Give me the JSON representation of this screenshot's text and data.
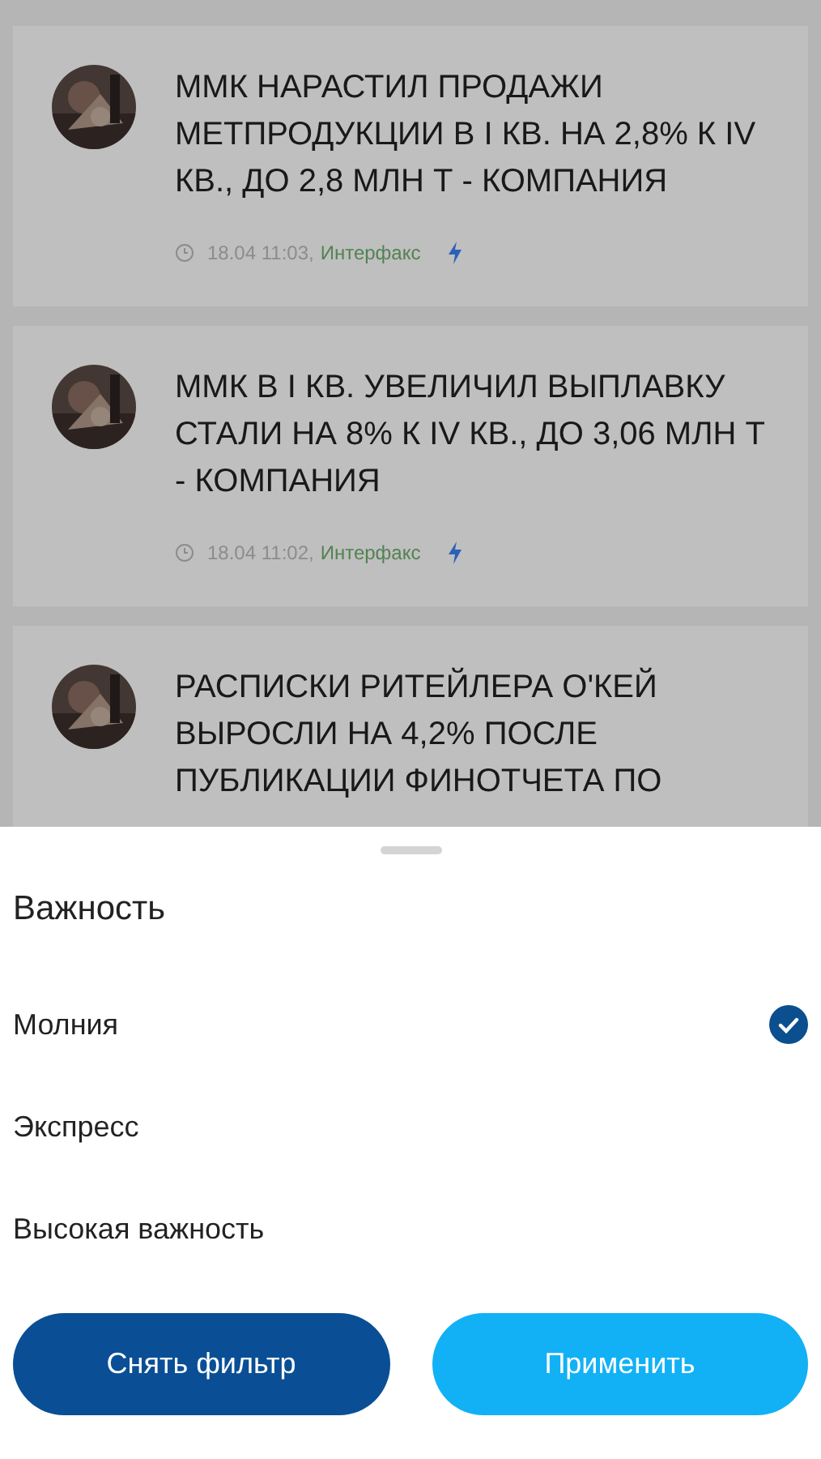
{
  "news": [
    {
      "title": "ММК НАРАСТИЛ ПРОДАЖИ МЕТПРОДУКЦИИ В I КВ. НА 2,8% К IV КВ., ДО 2,8 МЛН Т - КОМПАНИЯ",
      "time": "18.04 11:03,",
      "source": "Интерфакс",
      "kind": "flash"
    },
    {
      "title": "ММК В I КВ. УВЕЛИЧИЛ ВЫПЛАВКУ СТАЛИ НА 8% К IV КВ., ДО 3,06 МЛН Т - КОМПАНИЯ",
      "time": "18.04 11:02,",
      "source": "Интерфакс",
      "kind": "flash"
    },
    {
      "title": "РАСПИСКИ РИТЕЙЛЕРА О'КЕЙ ВЫРОСЛИ НА 4,2% ПОСЛЕ ПУБЛИКАЦИИ ФИНОТЧЕТА ПО"
    }
  ],
  "sheet": {
    "title": "Важность",
    "options": [
      {
        "label": "Молния",
        "selected": true
      },
      {
        "label": "Экспресс",
        "selected": false
      },
      {
        "label": "Высокая важность",
        "selected": false
      }
    ],
    "buttons": [
      {
        "label": "Снять фильтр",
        "kind": "secondary"
      },
      {
        "label": "Применить",
        "kind": "primary"
      }
    ]
  }
}
